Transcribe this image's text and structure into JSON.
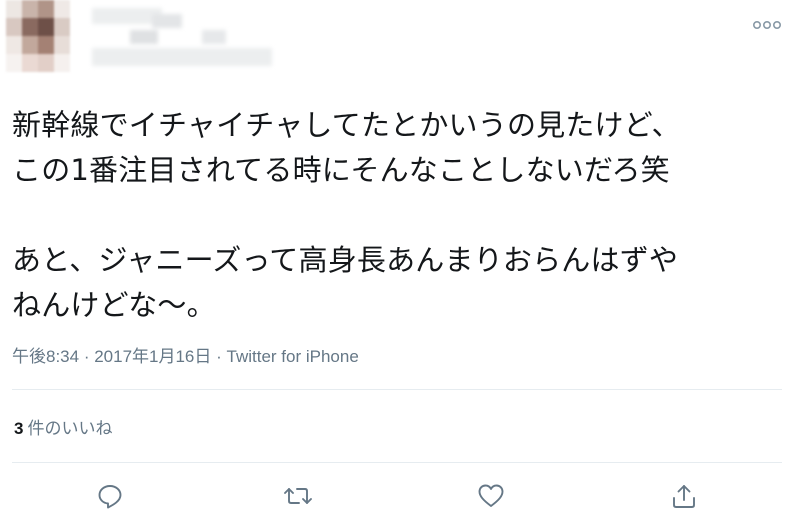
{
  "tweet": {
    "lines": [
      "新幹線でイチャイチャしてたとかいうの見たけど、",
      "この1番注目されてる時にそんなことしないだろ笑",
      "",
      "あと、ジャニーズって高身長あんまりおらんはずや",
      "ねんけどな〜。"
    ],
    "time": "午後8:34",
    "date": "2017年1月16日",
    "separator": " · ",
    "source": "Twitter for iPhone"
  },
  "engagement": {
    "likes_count": "3",
    "likes_label": "件のいいね"
  },
  "icons": {
    "more": "more-icon",
    "reply": "reply-icon",
    "retweet": "retweet-icon",
    "like": "heart-icon",
    "share": "share-icon"
  },
  "colors": {
    "text": "#14171a",
    "secondary": "#657786",
    "divider": "#e6ecf0"
  }
}
